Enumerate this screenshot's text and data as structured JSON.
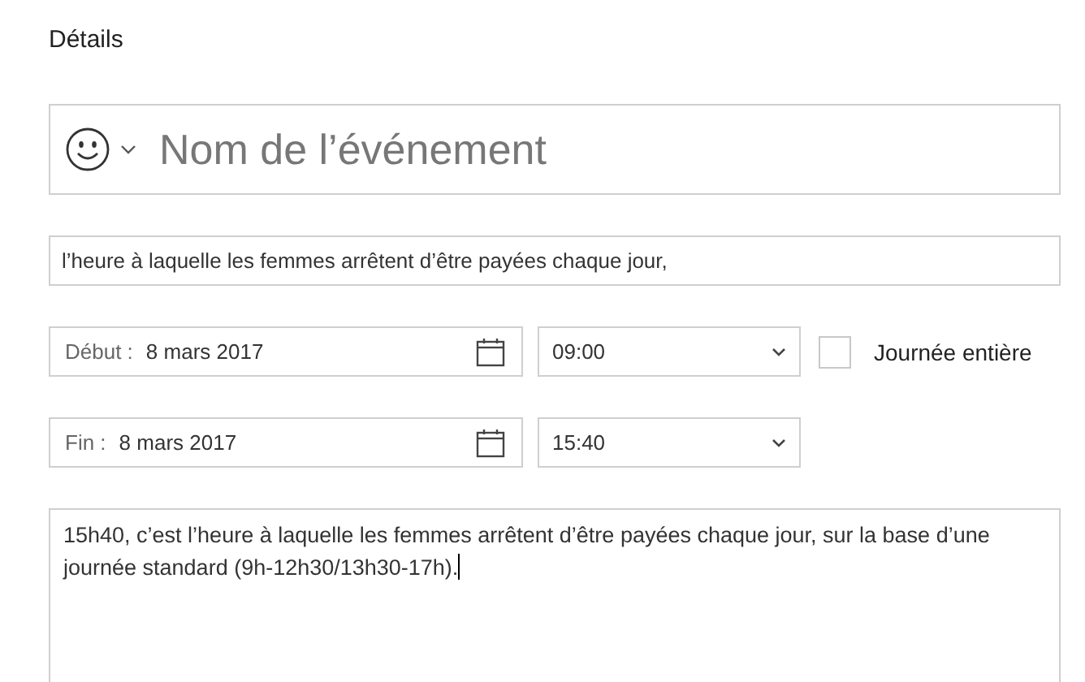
{
  "section_title": "Détails",
  "event_name": {
    "placeholder": "Nom de l’événement"
  },
  "location": {
    "value": "l’heure à laquelle les femmes arrêtent d’être payées chaque jour,"
  },
  "start": {
    "label": "Début :",
    "date": "8 mars 2017",
    "time": "09:00"
  },
  "end": {
    "label": "Fin :",
    "date": "8 mars 2017",
    "time": "15:40"
  },
  "all_day": {
    "label": "Journée entière",
    "checked": false
  },
  "notes": {
    "value": "15h40, c’est l’heure à laquelle les femmes arrêtent d’être payées chaque jour, sur la base d’une journée standard (9h-12h30/13h30-17h)."
  }
}
